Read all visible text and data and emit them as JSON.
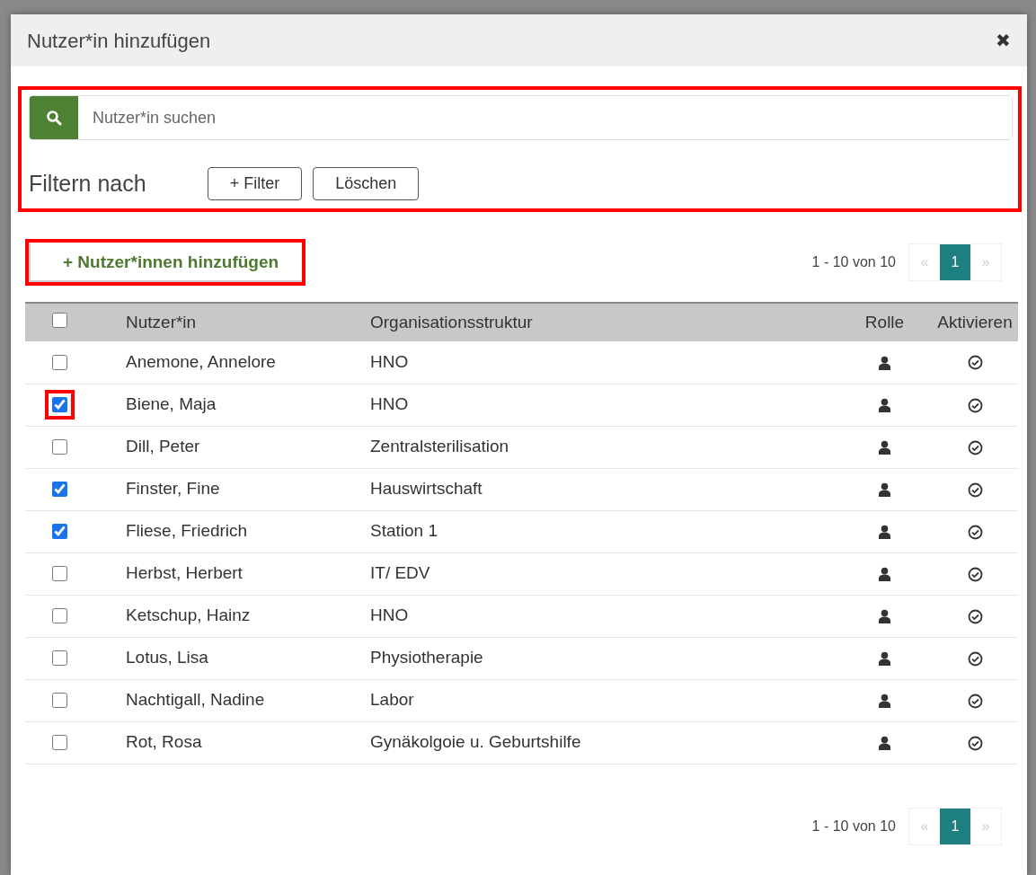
{
  "dialog": {
    "title": "Nutzer*in hinzufügen",
    "close": "✖"
  },
  "search": {
    "placeholder": "Nutzer*in suchen",
    "highlighted": true,
    "filter_label": "Filtern nach",
    "buttons": [
      "+ Filter",
      "Löschen"
    ]
  },
  "add_button": {
    "label": "+ Nutzer*innen hinzufügen",
    "highlighted": true
  },
  "pagination_top": {
    "range": "1 - 10 von 10",
    "prev": "«",
    "pages": [
      {
        "label": "1",
        "selected": true
      }
    ],
    "next": "»"
  },
  "table": {
    "select_all": {
      "checked": false
    },
    "columns": [
      "Nutzer*in",
      "Organisationsstruktur",
      "Rolle",
      "Aktivieren"
    ],
    "rows": [
      {
        "name": "Anemone, Annelore",
        "org": "HNO",
        "checked": false,
        "highlighted": false
      },
      {
        "name": "Biene, Maja",
        "org": "HNO",
        "checked": true,
        "highlighted": true
      },
      {
        "name": "Dill, Peter",
        "org": "Zentralsterilisation",
        "checked": false,
        "highlighted": false
      },
      {
        "name": "Finster, Fine",
        "org": "Hauswirtschaft",
        "checked": true,
        "highlighted": false
      },
      {
        "name": "Fliese, Friedrich",
        "org": "Station 1",
        "checked": true,
        "highlighted": false
      },
      {
        "name": "Herbst, Herbert",
        "org": "IT/ EDV",
        "checked": false,
        "highlighted": false
      },
      {
        "name": "Ketschup, Hainz",
        "org": "HNO",
        "checked": false,
        "highlighted": false
      },
      {
        "name": "Lotus, Lisa",
        "org": "Physiotherapie",
        "checked": false,
        "highlighted": false
      },
      {
        "name": "Nachtigall, Nadine",
        "org": "Labor",
        "checked": false,
        "highlighted": false
      },
      {
        "name": "Rot, Rosa",
        "org": "Gynäkolgoie u. Geburtshilfe",
        "checked": false,
        "highlighted": false
      }
    ]
  },
  "pagination_bottom": {
    "range": "1 - 10 von 10",
    "prev": "«",
    "pages": [
      {
        "label": "1",
        "selected": true
      }
    ],
    "next": "»"
  }
}
